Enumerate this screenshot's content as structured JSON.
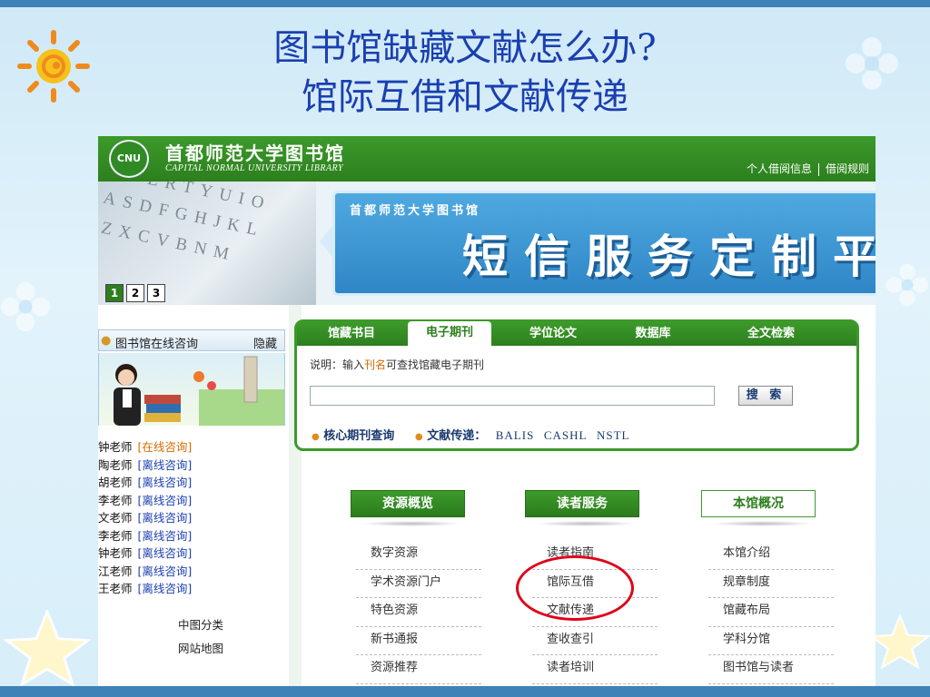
{
  "slide": {
    "title_line1": "图书馆缺藏文献怎么办?",
    "title_line2": "馆际互借和文献传递"
  },
  "site": {
    "seal_text": "CNU",
    "name_cn": "首都师范大学图书馆",
    "name_en": "CAPITAL NORMAL UNIVERSITY LIBRARY",
    "header_links": [
      "个人借阅信息",
      "借阅规则"
    ],
    "colors": {
      "brand_green": "#2d7f1e",
      "link_blue": "#1a3fb0",
      "online_orange": "#d46b00",
      "highlight_red": "#e0001a"
    }
  },
  "banner": {
    "keyboard_rows": [
      "QWERTYUIO",
      "ASDFGHJKL",
      "ZXCVBNM"
    ],
    "small_title": "首都师范大学图书馆",
    "big_title": "短信服务定制平",
    "pages": [
      "1",
      "2",
      "3"
    ]
  },
  "consult": {
    "icon": "person-icon",
    "title": "图书馆在线咨询",
    "hide_label": "隐藏",
    "teachers": [
      {
        "name": "钟老师",
        "status": "[在线咨询]",
        "online": true
      },
      {
        "name": "陶老师",
        "status": "[离线咨询]",
        "online": false
      },
      {
        "name": "胡老师",
        "status": "[离线咨询]",
        "online": false
      },
      {
        "name": "李老师",
        "status": "[离线咨询]",
        "online": false
      },
      {
        "name": "文老师",
        "status": "[离线咨询]",
        "online": false
      },
      {
        "name": "李老师",
        "status": "[离线咨询]",
        "online": false
      },
      {
        "name": "钟老师",
        "status": "[离线咨询]",
        "online": false
      },
      {
        "name": "江老师",
        "status": "[离线咨询]",
        "online": false
      },
      {
        "name": "王老师",
        "status": "[离线咨询]",
        "online": false
      }
    ],
    "links": [
      "中图分类",
      "网站地图"
    ]
  },
  "search": {
    "tabs": [
      "馆藏书目",
      "电子期刊",
      "学位论文",
      "数据库",
      "全文检索"
    ],
    "active_tab": "电子期刊",
    "desc_prefix": "说明：输入",
    "desc_highlight": "刊名",
    "desc_suffix": "可查找馆藏电子期刊",
    "button_label": "搜 索",
    "core_label": "核心期刊查询",
    "delivery_label": "文献传递：",
    "delivery_links": [
      "BALIS",
      "CASHL",
      "NSTL"
    ]
  },
  "sections": [
    {
      "title": "资源概览",
      "style": "green",
      "items": [
        "数字资源",
        "学术资源门户",
        "特色资源",
        "新书通报",
        "资源推荐"
      ]
    },
    {
      "title": "读者服务",
      "style": "green",
      "items": [
        "读者指南",
        "馆际互借",
        "文献传递",
        "查收查引",
        "读者培训"
      ]
    },
    {
      "title": "本馆概况",
      "style": "white",
      "items": [
        "本馆介绍",
        "规章制度",
        "馆藏布局",
        "学科分馆",
        "图书馆与读者"
      ]
    }
  ]
}
